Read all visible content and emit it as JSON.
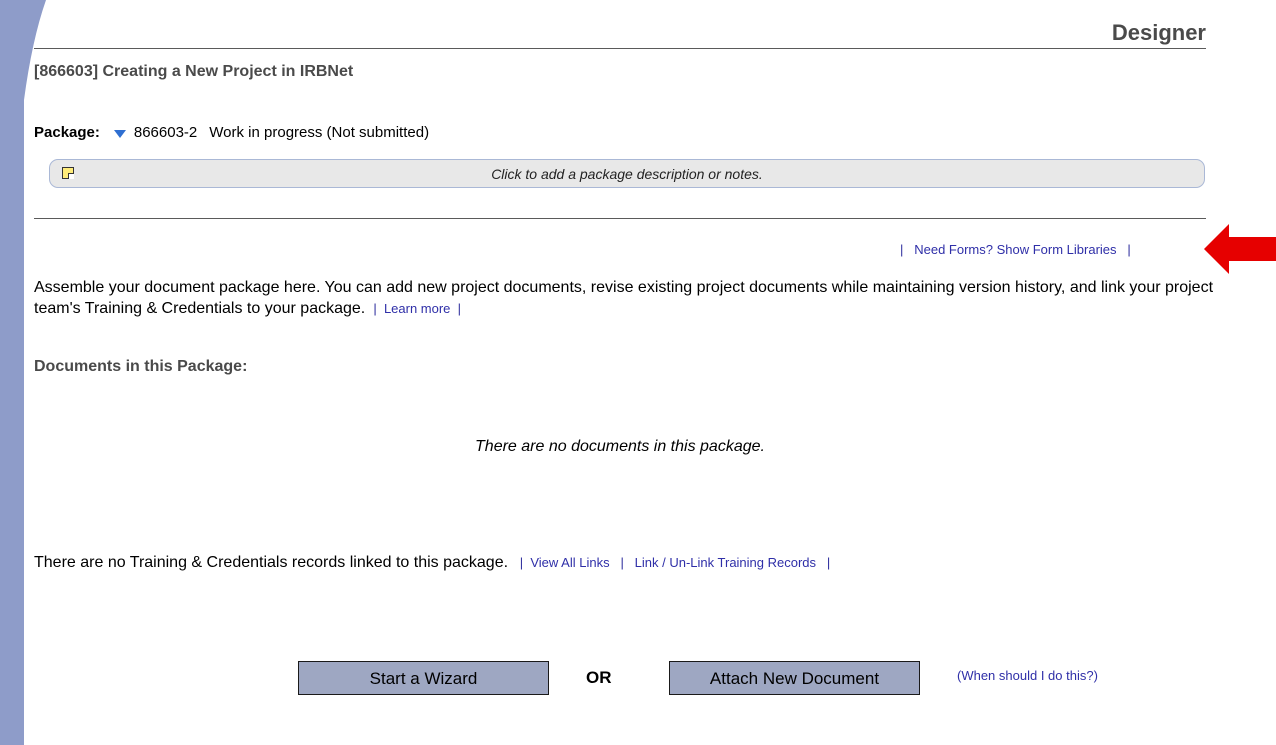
{
  "header": {
    "role_title": "Designer",
    "project_title": "[866603] Creating a New Project in IRBNet"
  },
  "package": {
    "label": "Package:",
    "number": "866603-2",
    "status": "Work in progress (Not submitted)",
    "notes_placeholder": "Click to add a package description or notes."
  },
  "links": {
    "pipe": "|",
    "need_forms": "Need Forms? Show Form Libraries",
    "learn_more": "Learn more",
    "view_all_links": "View All Links",
    "link_unlink_training": "Link / Un-Link Training Records",
    "when_should": "(When should I do this?)"
  },
  "content": {
    "assemble_text": "Assemble your document package here. You can add new project documents, revise existing project documents while maintaining version history, and link your project team's Training & Credentials to your package.",
    "documents_heading": "Documents in this Package:",
    "no_documents": "There are no documents in this package.",
    "no_training": "There are no Training & Credentials records linked to this package."
  },
  "actions": {
    "start_wizard": "Start a Wizard",
    "or": "OR",
    "attach_new": "Attach New Document"
  },
  "colors": {
    "left_bar": "#8e9cc9",
    "link": "#2f2fa8",
    "button_bg": "#9ea7c2",
    "arrow": "#e60000"
  }
}
